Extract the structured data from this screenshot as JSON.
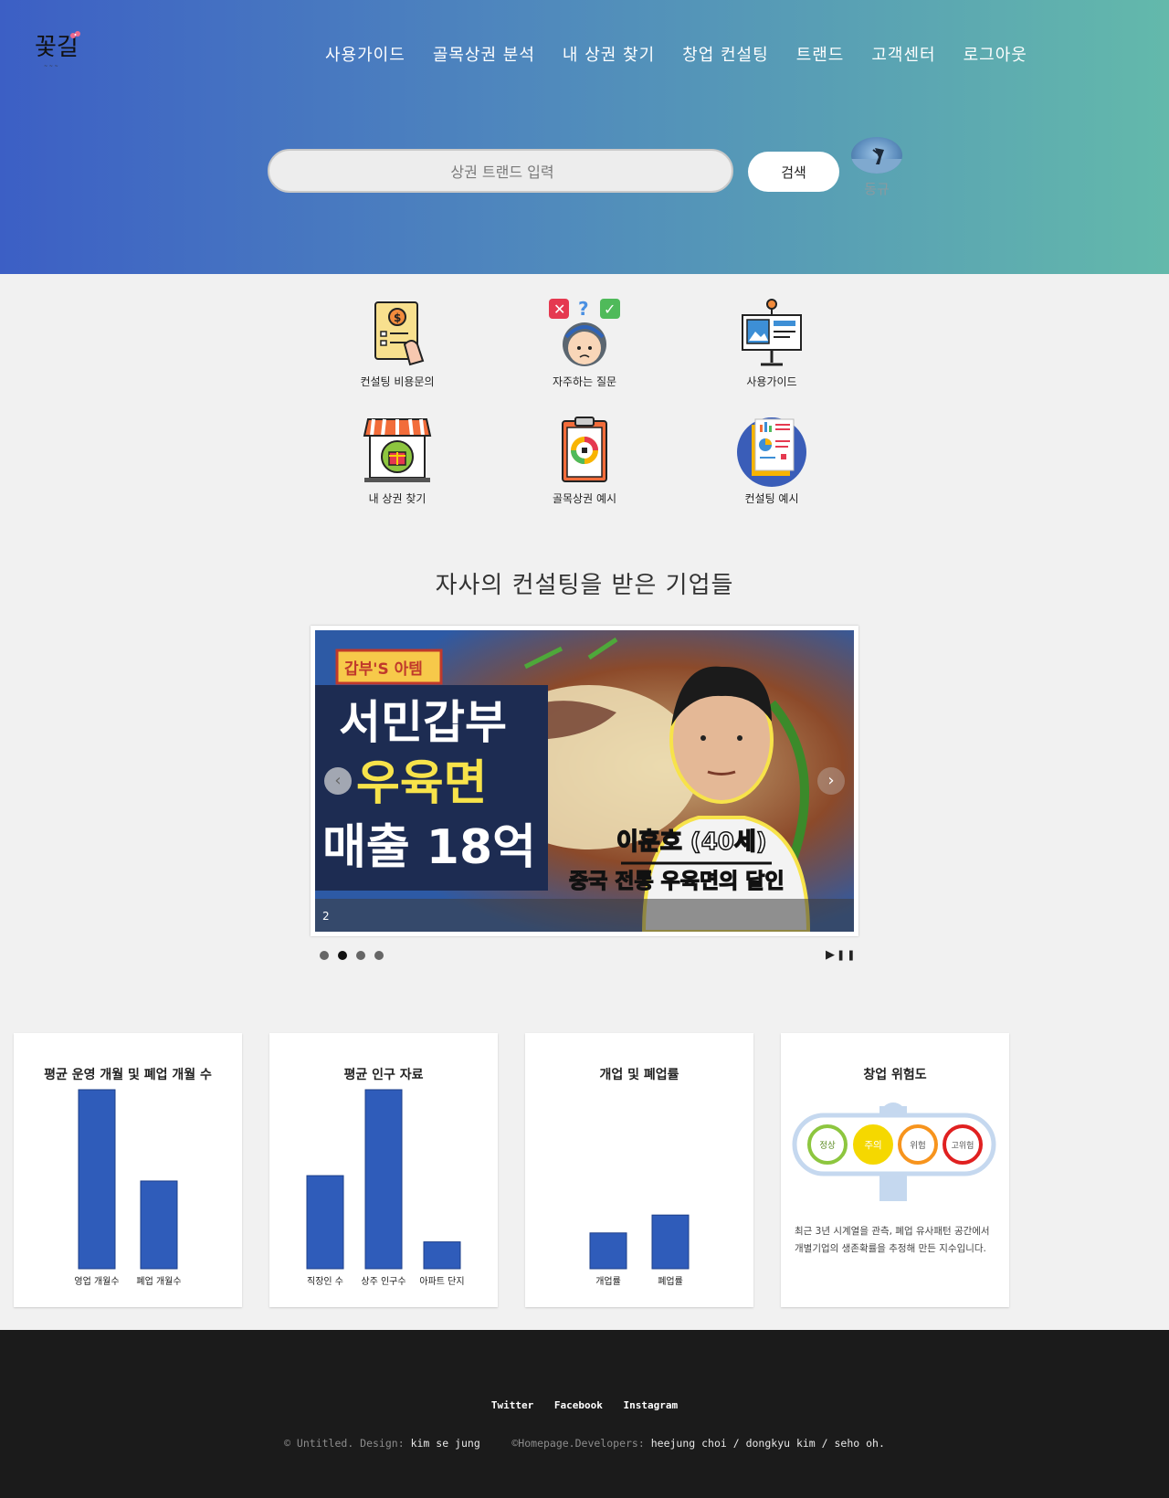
{
  "nav": [
    "사용가이드",
    "골목상권 분석",
    "내 상권 찾기",
    "창업 컨설팅",
    "트랜드",
    "고객센터",
    "로그아웃"
  ],
  "search": {
    "placeholder": "상권 트랜드 입력",
    "button": "검색"
  },
  "user": {
    "name": "동규"
  },
  "tiles": [
    {
      "label": "컨설팅 비용문의",
      "icon": "invoice-dollar-icon"
    },
    {
      "label": "자주하는 질문",
      "icon": "faq-person-icon"
    },
    {
      "label": "사용가이드",
      "icon": "presentation-board-icon"
    },
    {
      "label": "내 상권 찾기",
      "icon": "store-gift-icon"
    },
    {
      "label": "골목상권 예시",
      "icon": "clipboard-chart-icon"
    },
    {
      "label": "컨설팅 예시",
      "icon": "report-document-icon"
    }
  ],
  "section_title": "자사의 컨설팅을 받은 기업들",
  "slider": {
    "badge": "갑부'S 아템",
    "headline1": "서민갑부",
    "headline2": "우육면",
    "headline3": "매출 18억",
    "person": "이훈호 (40세)",
    "subtitle": "중국 전통 우육면의 달인",
    "caption_number": "2",
    "slide_count": 4,
    "active_slide": 2
  },
  "chart_data": [
    {
      "type": "bar",
      "title": "평균 운영 개월 및 폐업 개월 수",
      "categories": [
        "영업 개월수",
        "폐업 개월수"
      ],
      "values": [
        100,
        49
      ]
    },
    {
      "type": "bar",
      "title": "평균 인구 자료",
      "categories": [
        "직장인 수",
        "상주 인구수",
        "아파트 단지"
      ],
      "values": [
        52,
        100,
        15
      ]
    },
    {
      "type": "bar",
      "title": "개업 및 폐업률",
      "categories": [
        "개업률",
        "폐업률"
      ],
      "values": [
        20,
        30
      ]
    }
  ],
  "risk": {
    "title": "창업 위험도",
    "levels": [
      "정상",
      "주의",
      "위험",
      "고위험"
    ],
    "active_level": "주의",
    "description": "최근 3년 시계열을 관측, 폐업 유사패턴 공간에서 개별기업의 생존확률을 추정해 만든 지수입니다.",
    "colors": {
      "정상": "#8dc63f",
      "주의": "#f5d800",
      "위험": "#f7941d",
      "고위험": "#e02020"
    }
  },
  "footer": {
    "social": [
      "Twitter",
      "Facebook",
      "Instagram"
    ],
    "copyright_prefix": "© Untitled. Design:",
    "designer": "kim se jung",
    "dev_prefix": "©Homepage.Developers:",
    "developers": "heejung choi / dongkyu kim / seho oh."
  },
  "colors": {
    "bar": "#2f5cba",
    "header_left": "#3c5fc5",
    "header_right": "#63b9ab",
    "footer": "#1b1b1b"
  }
}
